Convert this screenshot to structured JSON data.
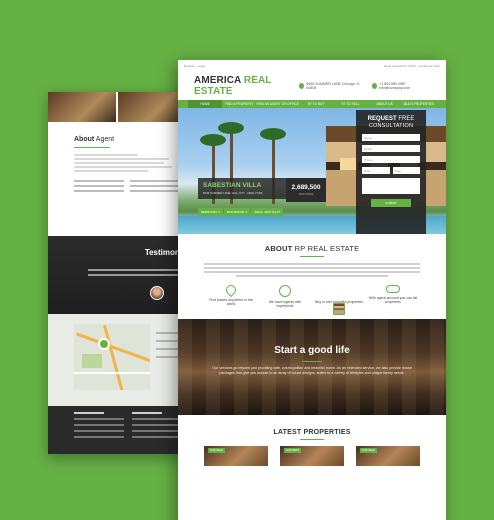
{
  "brand": {
    "name_part1": "AMERICA",
    "name_part2": "REAL ESTATE",
    "accent": "#66b144"
  },
  "topbar": {
    "left": "Register  ·  Login",
    "right": "Need Questions? 1-800  ·  Contact at Clear"
  },
  "header": {
    "address": "6646 SUMMER LANE Chicago, IL 60608",
    "phone": "+1 804 889 4987 info@company.com"
  },
  "nav": [
    {
      "label": "HOME"
    },
    {
      "label": "FIND A PROPERTY"
    },
    {
      "label": "FIND AN AGENT OR OFFICE"
    },
    {
      "label": "RT TO BUY"
    },
    {
      "label": "RT TO SELL"
    },
    {
      "label": "ABOUT US"
    },
    {
      "label": "MULTI PROPERTIES"
    }
  ],
  "hero": {
    "property_name": "SABESTIAN VILLA",
    "property_address": "6646 SUMMER LANE, HILL CITY · NEW YORK",
    "features": [
      "BEDROOM: 3",
      "BATHROOM: 2",
      "AREA: 4200 SQ.FT"
    ],
    "price": "2,689,500",
    "price_note": "NEW PRICE"
  },
  "request": {
    "title_bold": "REQUEST",
    "title_rest": "FREE",
    "subtitle": "CONSULTATION",
    "fields": [
      "Name",
      "Email",
      "Phone",
      "Date",
      "Time"
    ],
    "submit_label": "SUBMIT"
  },
  "about": {
    "title_bold": "ABOUT",
    "title_rest": "RP REAL ESTATE"
  },
  "features": [
    {
      "icon": "map-pin-icon",
      "text": "Find places anywhere in the world"
    },
    {
      "icon": "agent-icon",
      "text": "We have agents with experience"
    },
    {
      "icon": "house-icon",
      "text": "Buy or rent beautiful properties"
    },
    {
      "icon": "cloud-icon",
      "text": "With agent account you can list properties"
    }
  ],
  "good_life": {
    "title": "Start a good life",
    "text": "Our services go beyond just providing safe, cosmopolitan and beautiful home. As an extended service, we also provide house packages that give you access to an array of house designs, suited to a variety of lifestyles and unique family needs."
  },
  "latest": {
    "title": "LATEST PROPERTIES",
    "tags": [
      "FOR SALE",
      "FOR RENT",
      "FOR SALE"
    ]
  },
  "back_page": {
    "about_title_bold": "About",
    "about_title_rest": "Agent",
    "testimonials_title": "Testimoni"
  }
}
